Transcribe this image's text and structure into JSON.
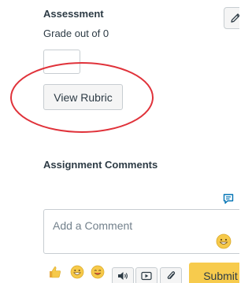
{
  "assessment": {
    "title": "Assessment",
    "grade_label": "Grade out of 0",
    "grade_value": "",
    "view_rubric_label": "View Rubric"
  },
  "comments": {
    "title": "Assignment Comments",
    "placeholder": "Add a Comment",
    "submit_label": "Submit"
  },
  "toolbar": {
    "emoji_quick": [
      "thumbs-up-icon",
      "grinning-face-icon",
      "smiling-face-icon"
    ],
    "buttons": [
      "media-audio-icon",
      "media-video-icon",
      "attachment-icon"
    ]
  },
  "colors": {
    "annotation": "#e0323a",
    "submit_bg": "#f7cb4d",
    "link": "#0374b5"
  }
}
